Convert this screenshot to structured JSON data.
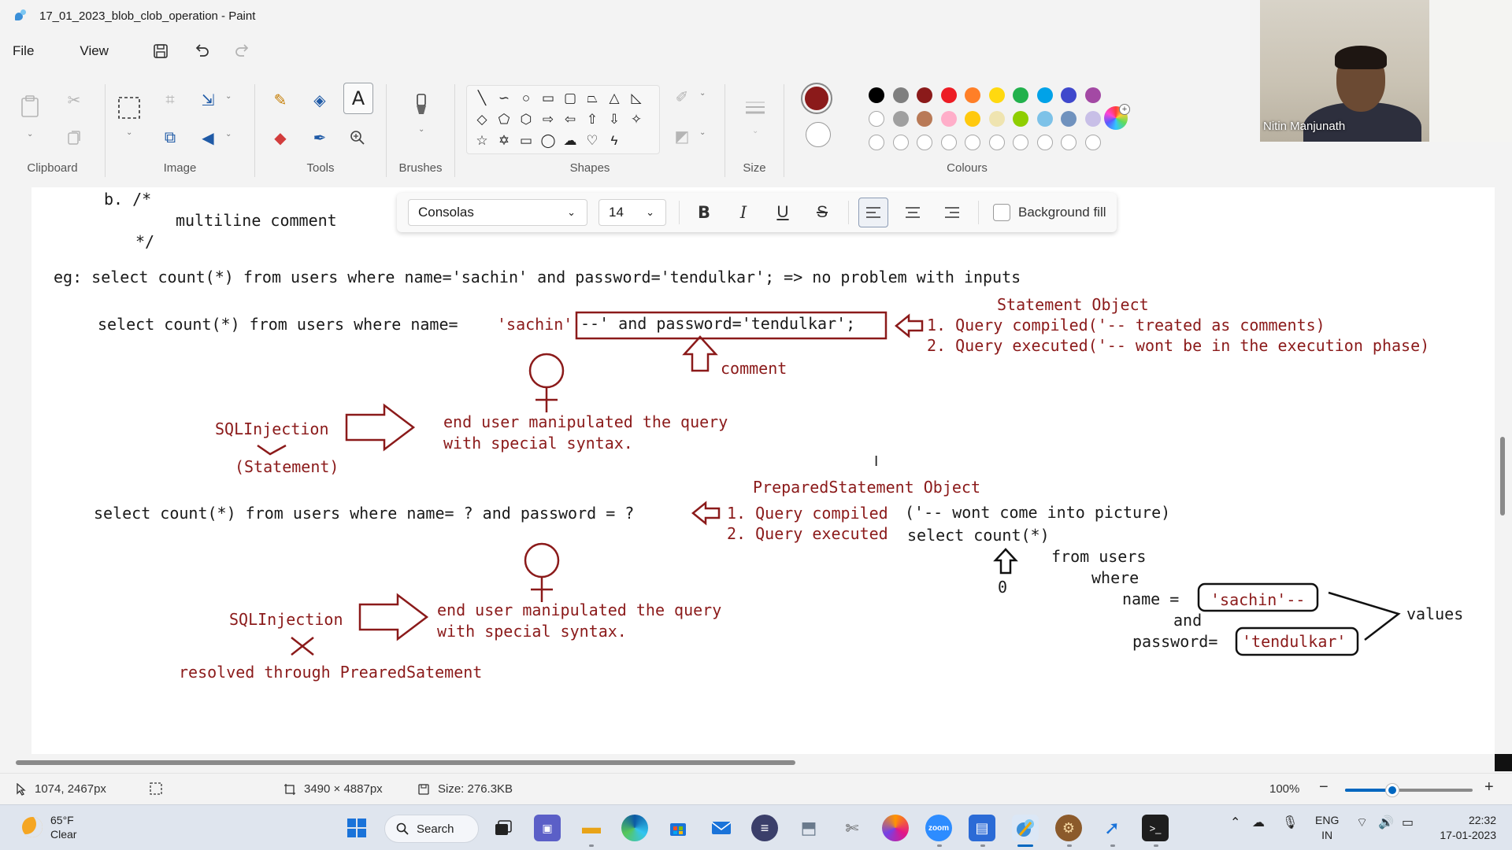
{
  "window": {
    "title": "17_01_2023_blob_clob_operation - Paint"
  },
  "menu": {
    "file": "File",
    "view": "View"
  },
  "ribbon": {
    "groups": {
      "clipboard": "Clipboard",
      "image": "Image",
      "tools": "Tools",
      "brushes": "Brushes",
      "shapes": "Shapes",
      "size": "Size",
      "colours": "Colours"
    },
    "active_color_1": "#8b1a1a",
    "palette_row1": [
      "#000000",
      "#7f7f7f",
      "#8b1a1a",
      "#ed1c24",
      "#ff7f27",
      "#ffd90f",
      "#22b14c",
      "#00a2e8",
      "#3f48cc",
      "#a349a4"
    ],
    "palette_row2": [
      "#ffffff",
      "#a0a0a0",
      "#b97a57",
      "#ffaec9",
      "#ffc90e",
      "#efe4b0",
      "#8fce00",
      "#7dc2e8",
      "#7092be",
      "#c8bfe7"
    ]
  },
  "webcam": {
    "name": "Nitin Manjunath"
  },
  "text_toolbar": {
    "font": "Consolas",
    "size": "14",
    "bg_fill": "Background fill"
  },
  "canvas": {
    "l1": "b. /*",
    "l2": "multiline comment",
    "l3": "*/",
    "l4": "eg: select count(*) from users where name='sachin' and password='tendulkar'; => no problem with inputs",
    "l5a": "select count(*) from users where name=",
    "l5b": "'sachin'",
    "l5c": "--' and password='tendulkar';",
    "so_title": "Statement Object",
    "so_1": "1. Query compiled('-- treated as comments)",
    "so_2": "2. Query executed('-- wont be in the execution phase)",
    "comment": "comment",
    "sqli1": "SQLInjection",
    "sqli1_sub": "(Statement)",
    "eu1a": "end user manipulated the query",
    "eu1b": "with special syntax.",
    "ps_title": "PreparedStatement Object",
    "l6": "select count(*) from users where name= ? and password = ?",
    "ps_1": "1. Query compiled",
    "ps_1b": "('-- wont come into picture)",
    "ps_2": "2. Query executed",
    "q1": "select count(*)",
    "q2": "from users",
    "q3": "where",
    "q4": "name =",
    "q5": "'sachin'--",
    "q6": "and",
    "q7": "password=",
    "q8": "'tendulkar'",
    "values": "values",
    "zero": "0",
    "sqli2": "SQLInjection",
    "eu2a": "end user manipulated the query",
    "eu2b": "with special syntax.",
    "resolved": "resolved through PrearedSatement"
  },
  "status": {
    "cursor": "1074, 2467px",
    "dimensions": "3490 × 4887px",
    "size": "Size: 276.3KB",
    "zoom": "100%",
    "zoom_level": 0.37
  },
  "taskbar": {
    "temp": "65°F",
    "weather": "Clear",
    "search": "Search",
    "lang1": "ENG",
    "lang2": "IN",
    "time": "22:32",
    "date": "17-01-2023"
  }
}
